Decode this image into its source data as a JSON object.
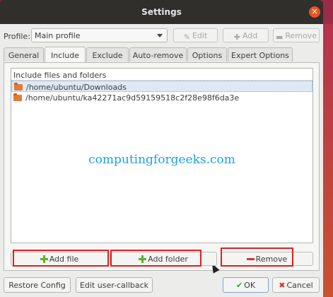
{
  "window": {
    "title": "Settings"
  },
  "profile": {
    "label": "Profile:",
    "selected": "Main profile",
    "edit_label": "Edit",
    "add_label": "Add",
    "remove_label": "Remove"
  },
  "tabs": [
    {
      "label": "General"
    },
    {
      "label": "Include"
    },
    {
      "label": "Exclude"
    },
    {
      "label": "Auto-remove"
    },
    {
      "label": "Options"
    },
    {
      "label": "Expert Options"
    }
  ],
  "include": {
    "header": "Include files and folders",
    "items": [
      {
        "path": "/home/ubuntu/Downloads"
      },
      {
        "path": "/home/ubuntu/ka42271ac9d59159518c2f28e98f6da3e"
      }
    ],
    "add_file_label": "Add file",
    "add_folder_label": "Add folder",
    "remove_label": "Remove"
  },
  "watermark": "computingforgeeks.com",
  "footer": {
    "restore_label": "Restore Config",
    "callback_label": "Edit user-callback",
    "ok_label": "OK",
    "cancel_label": "Cancel"
  },
  "colors": {
    "accent_close": "#e95420",
    "highlight_box": "#e0201f"
  }
}
